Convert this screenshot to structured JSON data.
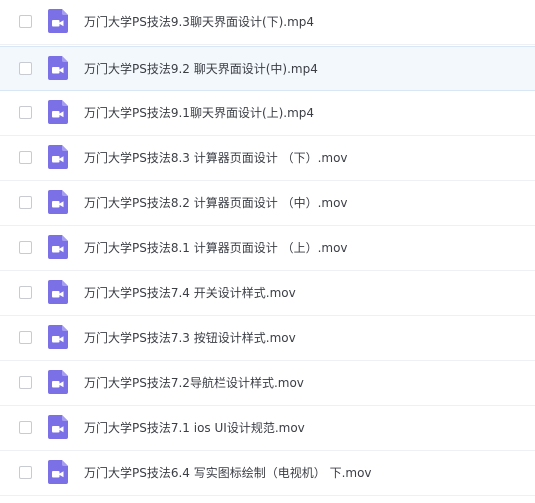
{
  "file_list": {
    "icon": "video-file-icon",
    "icon_color": "#7b70e6",
    "hover_row_background": "#f3f8fc",
    "items": [
      {
        "name": "万门大学PS技法9.3聊天界面设计(下).mp4",
        "checked": false
      },
      {
        "name": "万门大学PS技法9.2 聊天界面设计(中).mp4",
        "checked": false
      },
      {
        "name": "万门大学PS技法9.1聊天界面设计(上).mp4",
        "checked": false
      },
      {
        "name": "万门大学PS技法8.3 计算器页面设计 （下）.mov",
        "checked": false
      },
      {
        "name": "万门大学PS技法8.2 计算器页面设计 （中）.mov",
        "checked": false
      },
      {
        "name": "万门大学PS技法8.1 计算器页面设计 （上）.mov",
        "checked": false
      },
      {
        "name": "万门大学PS技法7.4 开关设计样式.mov",
        "checked": false
      },
      {
        "name": "万门大学PS技法7.3 按钮设计样式.mov",
        "checked": false
      },
      {
        "name": "万门大学PS技法7.2导航栏设计样式.mov",
        "checked": false
      },
      {
        "name": "万门大学PS技法7.1 ios UI设计规范.mov",
        "checked": false
      },
      {
        "name": "万门大学PS技法6.4 写实图标绘制（电视机） 下.mov",
        "checked": false
      }
    ]
  }
}
